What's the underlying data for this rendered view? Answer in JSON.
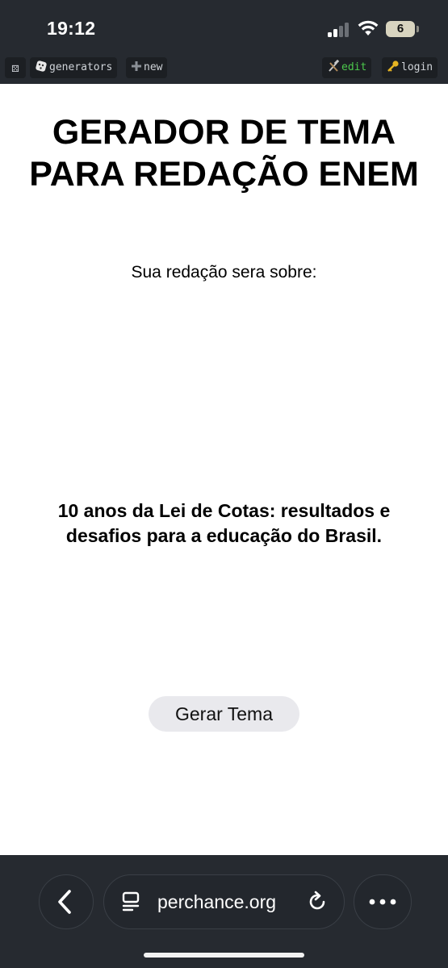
{
  "status_bar": {
    "time": "19:12",
    "battery": "6"
  },
  "top_bar": {
    "dice_icon": "⚄",
    "generators_label": "generators",
    "new_label": "new",
    "edit_label": "edit",
    "login_label": "login"
  },
  "main": {
    "title_line1": "GERADOR DE TEMA",
    "title_line2": "PARA REDAÇÃO ENEM",
    "subtitle": "Sua redação sera sobre:",
    "theme_line1": "10 anos da Lei de Cotas: resultados e",
    "theme_line2": "desafios para a educação do Brasil.",
    "generate_button": "Gerar Tema"
  },
  "browser": {
    "url": "perchance.org"
  },
  "colors": {
    "chrome_bg": "#262a30",
    "edit_green": "#4cc94c",
    "button_bg": "#e9e9ed"
  }
}
